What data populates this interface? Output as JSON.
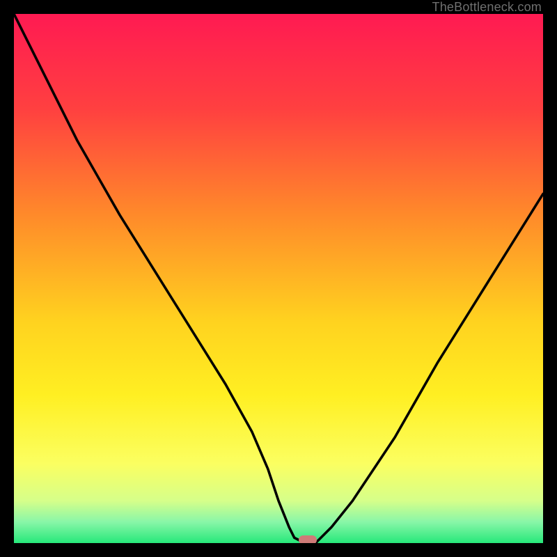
{
  "attribution": "TheBottleneck.com",
  "colors": {
    "frame": "#000000",
    "attribution": "#6f6f6f",
    "curve": "#000000",
    "marker": "#cf7b78",
    "gradient_stops": [
      {
        "pct": 0,
        "color": "#ff1a52"
      },
      {
        "pct": 18,
        "color": "#ff4040"
      },
      {
        "pct": 38,
        "color": "#ff8a2a"
      },
      {
        "pct": 58,
        "color": "#ffd21f"
      },
      {
        "pct": 72,
        "color": "#ffef22"
      },
      {
        "pct": 85,
        "color": "#fbff61"
      },
      {
        "pct": 92,
        "color": "#d6ff8a"
      },
      {
        "pct": 96,
        "color": "#89f6a8"
      },
      {
        "pct": 100,
        "color": "#26e87a"
      }
    ]
  },
  "chart_data": {
    "type": "line",
    "title": "",
    "xlabel": "",
    "ylabel": "",
    "x_range": [
      0,
      100
    ],
    "y_range": [
      0,
      100
    ],
    "grid": false,
    "series": [
      {
        "name": "bottleneck-curve",
        "x": [
          0,
          3,
          6,
          9,
          12,
          16,
          20,
          25,
          30,
          35,
          40,
          45,
          48,
          50,
          52,
          53,
          55,
          57,
          60,
          64,
          68,
          72,
          76,
          80,
          85,
          90,
          95,
          100
        ],
        "y": [
          100,
          94,
          88,
          82,
          76,
          69,
          62,
          54,
          46,
          38,
          30,
          21,
          14,
          8,
          3,
          1,
          0,
          0,
          3,
          8,
          14,
          20,
          27,
          34,
          42,
          50,
          58,
          66
        ]
      }
    ],
    "annotations": [
      {
        "name": "min-marker",
        "type": "rect_rounded",
        "x": 55.5,
        "y": 0.6,
        "width_pct": 3.4,
        "height_pct": 1.6,
        "color": "#cf7b78"
      }
    ]
  }
}
